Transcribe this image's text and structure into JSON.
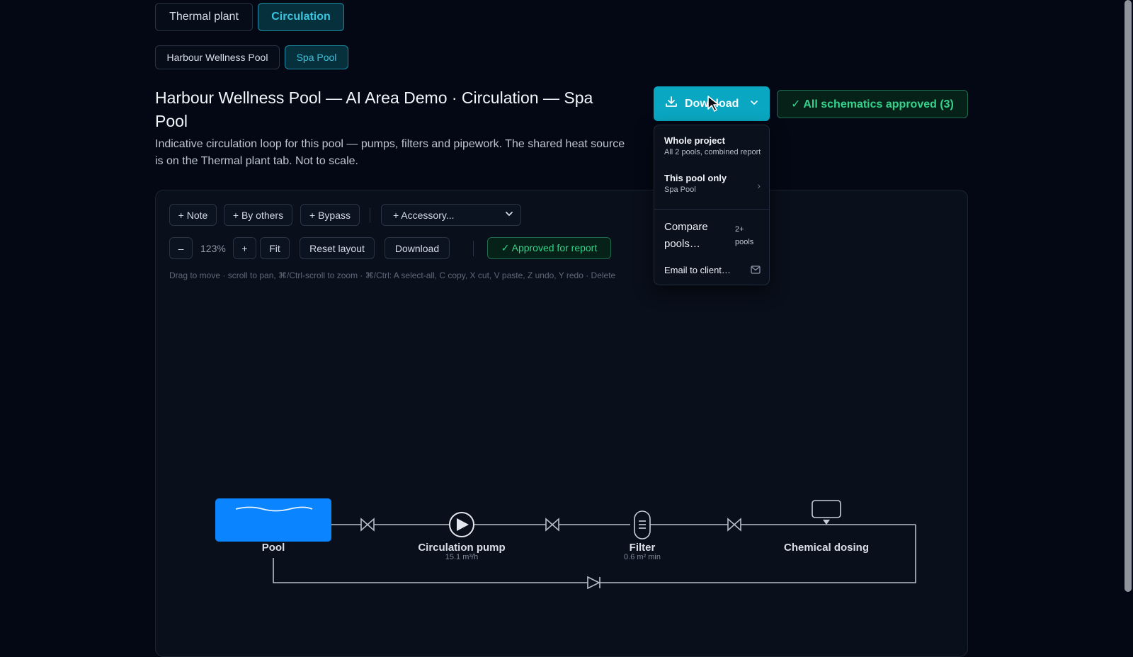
{
  "main_tabs": [
    {
      "label": "Thermal plant",
      "active": false
    },
    {
      "label": "Circulation",
      "active": true
    }
  ],
  "pool_tabs": [
    {
      "label": "Harbour Wellness Pool",
      "active": false
    },
    {
      "label": "Spa Pool",
      "active": true
    }
  ],
  "header": {
    "title": "Harbour Wellness Pool — AI Area Demo · Circulation — Spa Pool",
    "description": "Indicative circulation loop for this pool — pumps, filters and pipework. The shared heat source is on the Thermal plant tab. Not to scale."
  },
  "download_button": {
    "label": "Download",
    "icon": "download-icon",
    "chevron": "chevron-down-icon"
  },
  "approved_all_badge": "✓ All schematics approved (3)",
  "download_menu": {
    "items": [
      {
        "title": "Whole project",
        "subtitle": "All 2 pools, combined report"
      },
      {
        "title": "This pool only",
        "subtitle": "Spa Pool",
        "chevron": "›"
      },
      {
        "title": "Compare pools…",
        "badge": "2+ pools"
      },
      {
        "title": "Email to client…",
        "icon": "mail-icon"
      }
    ]
  },
  "toolbar": {
    "note": "+ Note",
    "by_others": "+ By others",
    "bypass": "+ Bypass",
    "accessory_select": "+ Accessory...",
    "zoom_out": "–",
    "zoom_level": "123%",
    "zoom_in": "+",
    "fit": "Fit",
    "reset_layout": "Reset layout",
    "download": "Download",
    "approved_for_report": "✓ Approved for report"
  },
  "hint": "Drag to move · scroll to pan, ⌘/Ctrl-scroll to zoom · ⌘/Ctrl: A select-all, C copy, X cut, V paste, Z undo, Y redo · Delete",
  "diagram": {
    "nodes": [
      {
        "label": "Pool",
        "sub": ""
      },
      {
        "label": "Circulation pump",
        "sub": "15.1 m³/h"
      },
      {
        "label": "Filter",
        "sub": "0.6 m² min"
      },
      {
        "label": "Chemical dosing",
        "sub": ""
      }
    ]
  },
  "colors": {
    "background": "#030814",
    "accent": "#0aa7c2",
    "approved_green": "#34d28c",
    "pool_blue": "#0a84ff",
    "pipe": "#b8bec8"
  }
}
